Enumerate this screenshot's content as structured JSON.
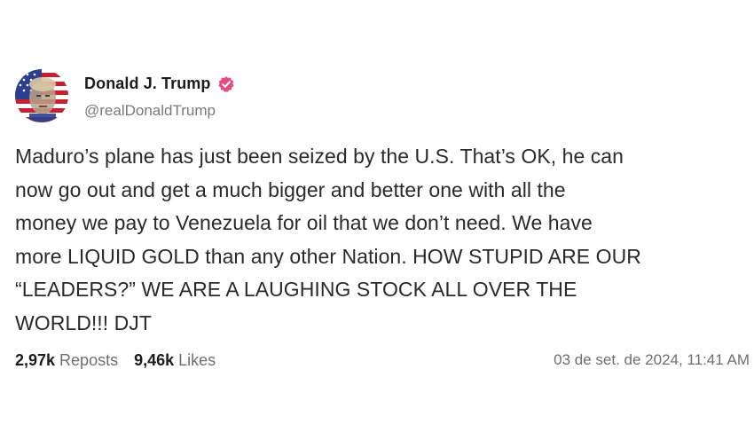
{
  "post": {
    "display_name": "Donald J. Trump",
    "handle": "@realDonaldTrump",
    "verified_icon": "verified-badge-icon",
    "accent_color": "#e64b86",
    "body_lines": [
      "Maduro’s plane has just been seized by the U.S. That’s OK, he can",
      "now go out and get a much bigger and better one with all the",
      "money we pay to Venezuela for oil that we don’t need. We have",
      "more LIQUID GOLD than any other Nation. HOW STUPID ARE OUR",
      "“LEADERS?” WE ARE A LAUGHING STOCK ALL OVER THE",
      "WORLD!!! DJT"
    ],
    "reposts_count": "2,97k",
    "reposts_label": "Reposts",
    "likes_count": "9,46k",
    "likes_label": "Likes",
    "timestamp": "03 de set. de 2024, 11:41 AM"
  }
}
